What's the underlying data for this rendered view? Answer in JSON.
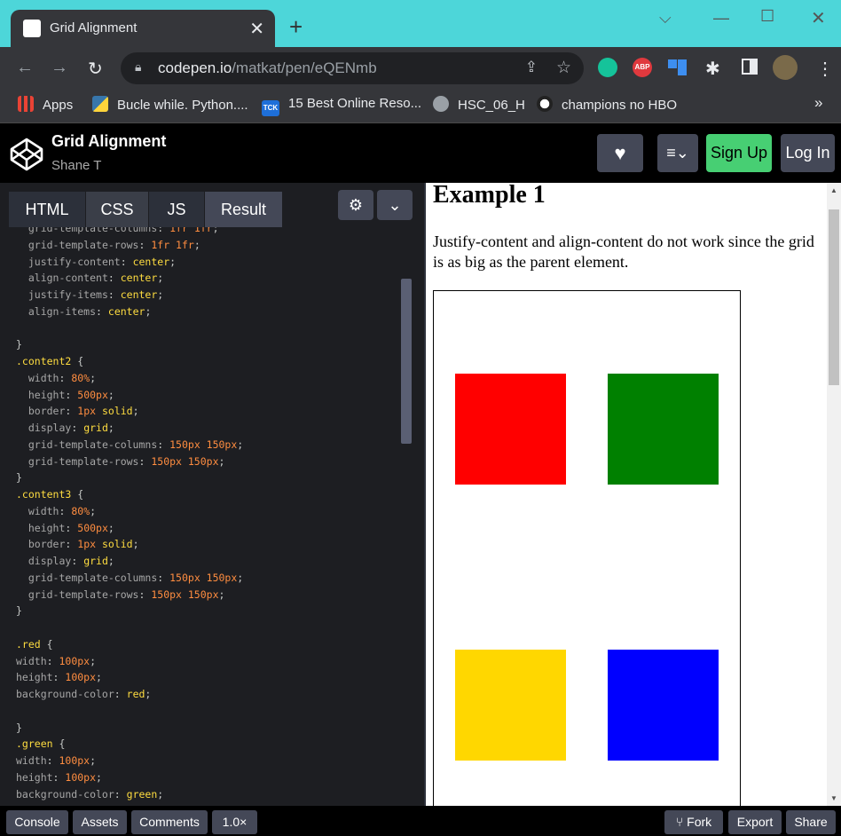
{
  "browser": {
    "tab_title": "Grid Alignment",
    "tab_close": "✕",
    "new_tab": "+",
    "url_host": "codepen.io",
    "url_path": "/matkat/pen/eQENmb",
    "bookmarks": [
      {
        "label": "Apps"
      },
      {
        "label": "Bucle while. Python...."
      },
      {
        "label": "15 Best Online Reso..."
      },
      {
        "label": "HSC_06_H"
      },
      {
        "label": "champions no HBO"
      }
    ],
    "bookmarks_more": "»",
    "abp_label": "ABP",
    "tck_label": "TCK"
  },
  "codepen": {
    "title": "Grid Alignment",
    "author": "Shane T",
    "signup": "Sign Up",
    "login": "Log In",
    "tabs": [
      "HTML",
      "CSS",
      "JS",
      "Result"
    ]
  },
  "result": {
    "heading": "Example 1",
    "paragraph": "Justify-content and align-content do not work since the grid is as big as the parent element."
  },
  "footer": {
    "console": "Console",
    "assets": "Assets",
    "comments": "Comments",
    "zoom": "1.0×",
    "fork": "Fork",
    "export": "Export",
    "share": "Share"
  },
  "colors": {
    "tab_strip": "#4dd6d9",
    "signup_green": "#47cf73",
    "red_square": "#ff0000",
    "green_square": "#008000",
    "yellow_square": "#ffd700",
    "blue_square": "#0000ff"
  }
}
